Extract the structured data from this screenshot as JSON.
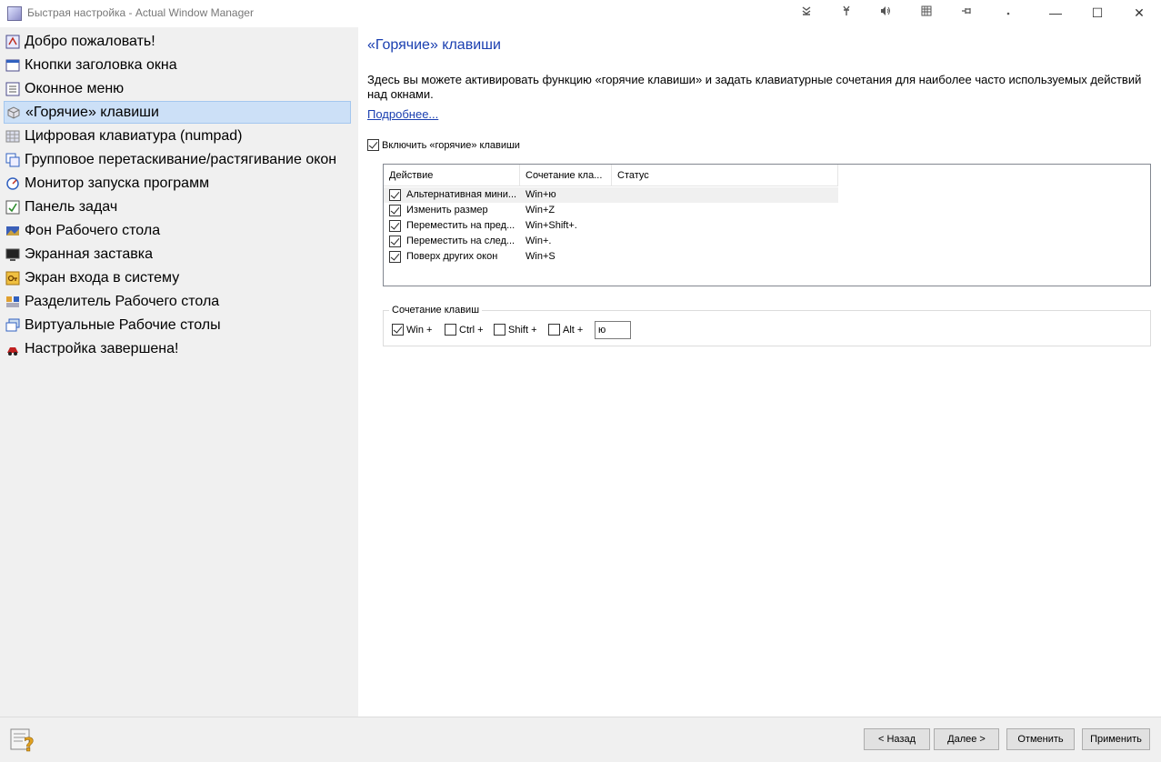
{
  "window": {
    "title": "Быстрая настройка - Actual Window Manager",
    "toolbar_icons": [
      "collapse-icon",
      "pin-icon",
      "speaker-icon",
      "grid-icon",
      "pushpin-icon",
      "dot-icon"
    ],
    "minimize": "—",
    "maximize": "☐",
    "close": "✕"
  },
  "sidebar": {
    "items": [
      {
        "label": "Добро пожаловать!",
        "icon": "welcome-icon",
        "selected": false
      },
      {
        "label": "Кнопки заголовка окна",
        "icon": "title-buttons-icon",
        "selected": false
      },
      {
        "label": "Оконное меню",
        "icon": "window-menu-icon",
        "selected": false
      },
      {
        "label": "«Горячие» клавиши",
        "icon": "hotkeys-icon",
        "selected": true
      },
      {
        "label": "Цифровая клавиатура (numpad)",
        "icon": "numpad-icon",
        "selected": false
      },
      {
        "label": "Групповое перетаскивание/растягивание окон",
        "icon": "group-drag-icon",
        "selected": false
      },
      {
        "label": "Монитор запуска программ",
        "icon": "startup-monitor-icon",
        "selected": false
      },
      {
        "label": "Панель задач",
        "icon": "taskbar-icon",
        "selected": false
      },
      {
        "label": "Фон Рабочего стола",
        "icon": "wallpaper-icon",
        "selected": false
      },
      {
        "label": "Экранная заставка",
        "icon": "screensaver-icon",
        "selected": false
      },
      {
        "label": "Экран входа в систему",
        "icon": "logon-screen-icon",
        "selected": false
      },
      {
        "label": "Разделитель Рабочего стола",
        "icon": "desktop-divider-icon",
        "selected": false
      },
      {
        "label": "Виртуальные Рабочие столы",
        "icon": "virtual-desktops-icon",
        "selected": false
      },
      {
        "label": "Настройка завершена!",
        "icon": "finish-icon",
        "selected": false
      }
    ]
  },
  "main": {
    "heading": "«Горячие» клавиши",
    "description": "Здесь вы можете активировать функцию «горячие клавиши» и задать клавиатурные сочетания для наиболее часто используемых действий над окнами.",
    "more_link": "Подробнее...",
    "enable_label": "Включить «горячие» клавиши",
    "enable_checked": true,
    "columns": [
      "Действие",
      "Сочетание кла...",
      "Статус"
    ],
    "rows": [
      {
        "action": "Альтернативная мини...",
        "combo": "Win+ю",
        "status": "",
        "checked": true
      },
      {
        "action": "Изменить размер",
        "combo": "Win+Z",
        "status": "",
        "checked": true
      },
      {
        "action": "Переместить на пред...",
        "combo": "Win+Shift+.",
        "status": "",
        "checked": true
      },
      {
        "action": "Переместить на след...",
        "combo": "Win+.",
        "status": "",
        "checked": true
      },
      {
        "action": "Поверх других окон",
        "combo": "Win+S",
        "status": "",
        "checked": true
      }
    ],
    "shortcut_group": {
      "title": "Сочетание клавиш",
      "modifiers": [
        {
          "label": "Win +",
          "checked": true
        },
        {
          "label": "Ctrl +",
          "checked": false
        },
        {
          "label": "Shift +",
          "checked": false
        },
        {
          "label": "Alt +",
          "checked": false
        }
      ],
      "key_value": "ю"
    }
  },
  "footer": {
    "help_icon": "help-icon",
    "back": "< Назад",
    "next": "Далее >",
    "cancel": "Отменить",
    "apply": "Применить"
  }
}
